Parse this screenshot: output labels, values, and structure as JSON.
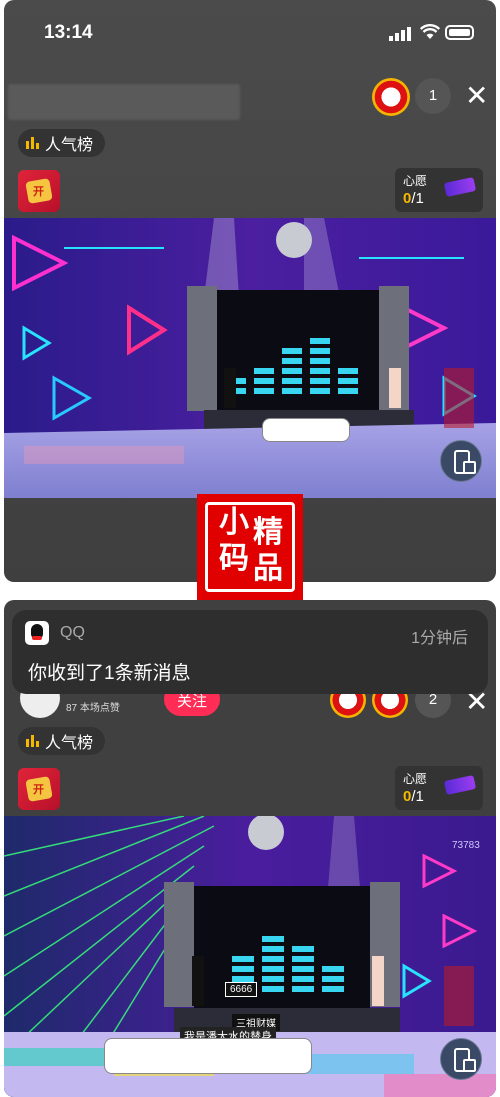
{
  "status_bar": {
    "time": "13:14"
  },
  "screen1": {
    "viewer_count": "1",
    "hot_rank_label": "人气榜",
    "wish": {
      "label": "心愿",
      "current": "0",
      "total": "/1"
    }
  },
  "seal": {
    "chars": [
      "小",
      "精",
      "码",
      "品"
    ],
    "color": "#e10000"
  },
  "notification": {
    "app": "QQ",
    "time": "1分钟后",
    "message": "你收到了1条新消息"
  },
  "screen2": {
    "likes_text": "87 本场点赞",
    "follow_label": "关注",
    "viewer_count": "2",
    "hot_rank_label": "人气榜",
    "wish": {
      "label": "心愿",
      "current": "0",
      "total": "/1"
    },
    "stage_score": "6666",
    "caption_line1": "三祖财媒",
    "caption_line2": "我是潘大水的替身",
    "side_digits": "73783"
  },
  "colors": {
    "accent": "#f5b800",
    "follow": "#ff2d55",
    "seal": "#e10000"
  }
}
